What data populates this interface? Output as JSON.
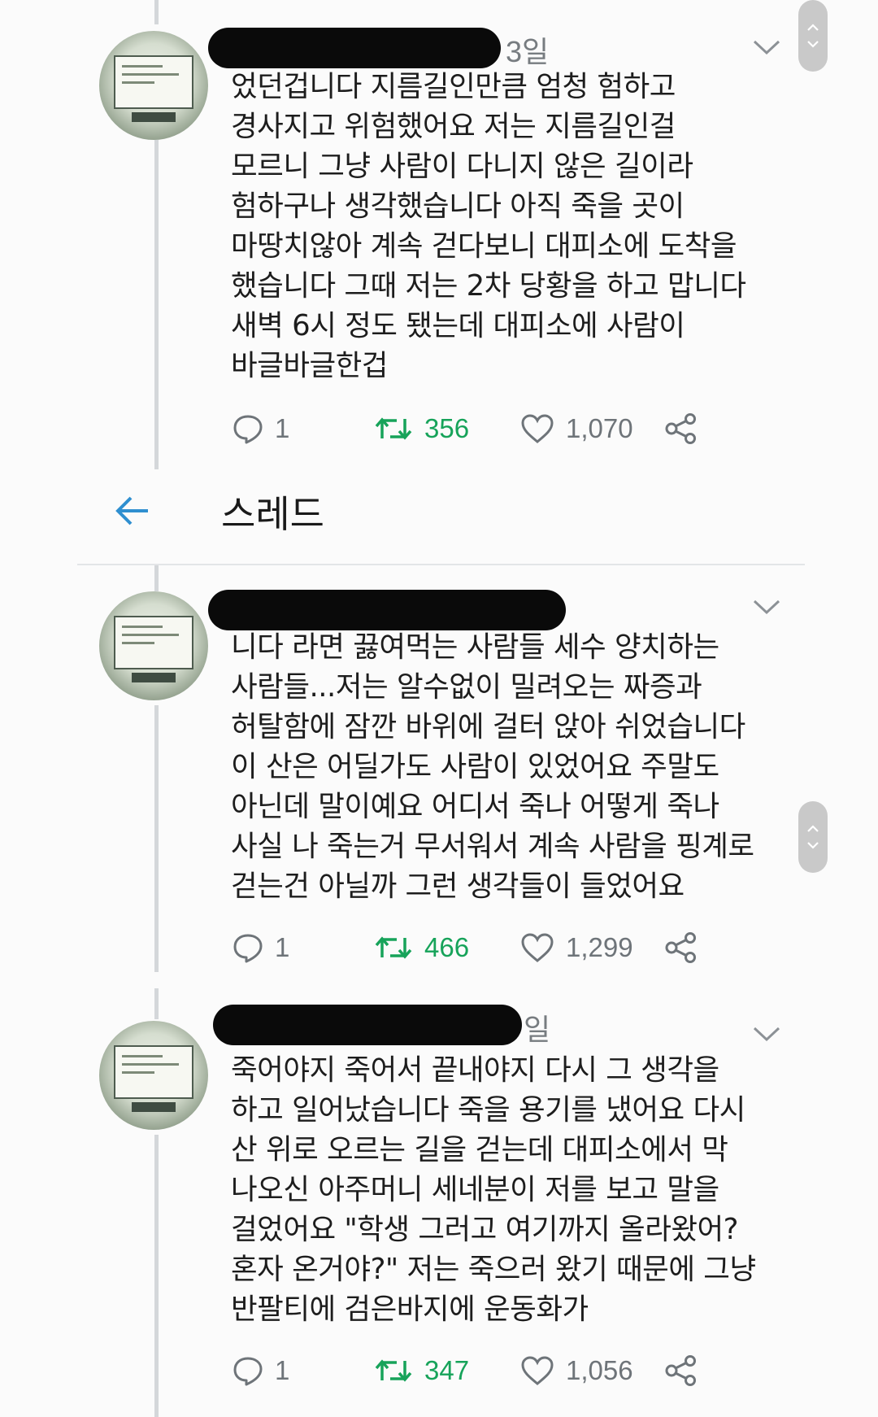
{
  "colors": {
    "background": "#fbfbfb",
    "text": "#1d1d1d",
    "muted": "#777c80",
    "retweet_green": "#17a35a",
    "back_arrow_blue": "#2f8fd0",
    "redaction": "#0a0a0a"
  },
  "thread_header": {
    "back_icon": "arrow-left-icon",
    "title": "스레드"
  },
  "tweets": [
    {
      "time": "3일",
      "text": "었던겁니다 지름길인만큼 엄청 험하고\n경사지고 위험했어요 저는 지름길인걸\n모르니 그냥 사람이 다니지 않은 길이라\n험하구나 생각했습니다 아직 죽을 곳이\n마땅치않아 계속 걷다보니 대피소에 도착을\n했습니다 그때 저는 2차 당황을 하고 맙니다\n새벽 6시 정도 됐는데 대피소에 사람이\n바글바글한겁",
      "replies": "1",
      "retweets": "356",
      "likes": "1,070"
    },
    {
      "time": "",
      "text": "니다 라면 끓여먹는 사람들 세수 양치하는\n사람들...저는 알수없이 밀려오는 짜증과\n허탈함에 잠깐 바위에 걸터 앉아 쉬었습니다\n이 산은 어딜가도 사람이 있었어요 주말도\n아닌데 말이예요 어디서 죽나 어떻게 죽나\n사실 나 죽는거 무서워서 계속 사람을 핑계로\n걷는건 아닐까 그런 생각들이 들었어요",
      "replies": "1",
      "retweets": "466",
      "likes": "1,299"
    },
    {
      "time": "일",
      "text": "죽어야지 죽어서 끝내야지 다시 그 생각을\n하고 일어났습니다 죽을 용기를 냈어요 다시\n산 위로 오르는 길을 걷는데 대피소에서 막\n나오신 아주머니 세네분이 저를 보고 말을\n걸었어요 \"학생 그러고 여기까지 올라왔어?\n혼자 온거야?\" 저는 죽으러 왔기 때문에 그냥\n반팔티에 검은바지에 운동화가",
      "replies": "1",
      "retweets": "347",
      "likes": "1,056"
    }
  ]
}
